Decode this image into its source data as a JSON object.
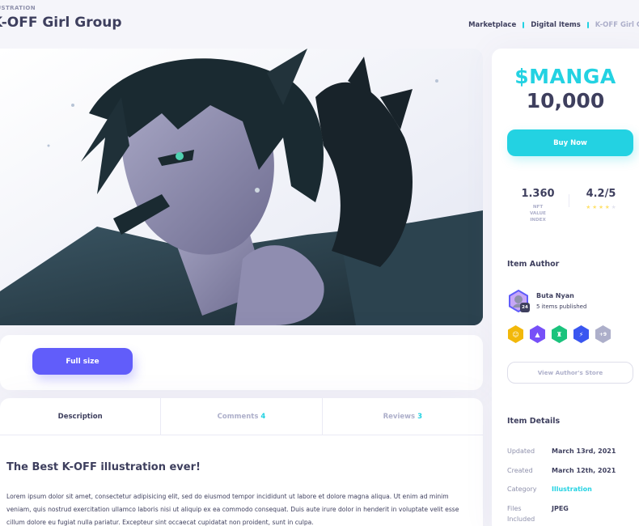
{
  "header": {
    "kicker": "llustration",
    "title": "K-OFF Girl Group",
    "breadcrumbs": [
      "Marketplace",
      "Digital Items",
      "K-OFF Girl Grou"
    ]
  },
  "hero": {
    "alt": "anime illustration of a dark-haired character"
  },
  "fullsize_button": "Full size",
  "tabs": [
    {
      "label": "Description",
      "count": ""
    },
    {
      "label": "Comments",
      "count": "4"
    },
    {
      "label": "Reviews",
      "count": "3"
    }
  ],
  "description": {
    "heading": "The Best K-OFF illustration ever!",
    "body": "Lorem ipsum dolor sit amet, consectetur adipisicing elit, sed do eiusmod tempor incididunt ut labore et dolore magna aliqua. Ut enim ad minim veniam, quis nostrud exercitation ullamco laboris nisi ut aliquip ex ea commodo consequat. Duis aute irure dolor in henderit in voluptate velit esse cillum dolore eu fugiat nulla pariatur. Excepteur sint occaecat cupidatat non proident, sunt in culpa."
  },
  "sidebar": {
    "currency": "$MANGA",
    "price": "10,000",
    "buy_button": "Buy Now",
    "stats": {
      "nft_value": "1.360",
      "nft_label": "NFT VALUE INDEX",
      "rating": "4.2/5",
      "rating_stars": 4,
      "rating_max": 5
    },
    "author_heading": "Item Author",
    "author": {
      "name": "Buta Nyan",
      "meta": "5 items published",
      "level": "24"
    },
    "badges": [
      {
        "icon": "smiley-badge-icon",
        "color": "#f2b80a"
      },
      {
        "icon": "hat-badge-icon",
        "color": "#7750f8"
      },
      {
        "icon": "trophy-badge-icon",
        "color": "#1bc37d"
      },
      {
        "icon": "bolt-badge-icon",
        "color": "#3a56f0"
      },
      {
        "icon": "more-badge-icon",
        "color": "#adafca",
        "label": "+9"
      }
    ],
    "store_button": "View Author's Store",
    "details_heading": "Item Details",
    "details": [
      {
        "key": "Updated",
        "value": "March 13rd, 2021"
      },
      {
        "key": "Created",
        "value": "March 12th, 2021"
      },
      {
        "key": "Category",
        "value": "Illustration"
      },
      {
        "key": "Files Included",
        "value": "JPEG"
      }
    ]
  },
  "colors": {
    "accent": "#23d2e2",
    "primary": "#615dfa",
    "text": "#3e3f5e",
    "muted": "#adafca"
  }
}
